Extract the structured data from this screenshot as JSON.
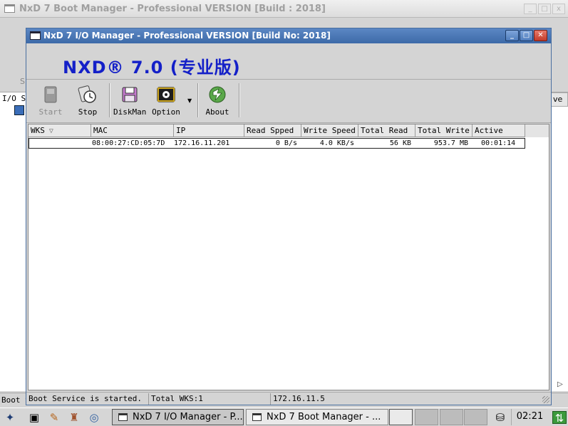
{
  "background_window": {
    "title": "NxD 7 Boot Manager - Professional VERSION [Build : 2018]",
    "tree_label": "I/O S",
    "status_text": "Boot S",
    "column_fragment": "ve",
    "tool_fragment": "S"
  },
  "main_window": {
    "title": "NxD 7 I/O Manager - Professional VERSION [Build No: 2018]",
    "banner": "NXD® 7.0 (专业版)",
    "toolbar": {
      "start_label": "Start",
      "stop_label": "Stop",
      "diskman_label": "DiskMan",
      "option_label": "Option",
      "about_label": "About"
    },
    "columns": [
      "WKS",
      "MAC",
      "IP",
      "Read Spped",
      "Write Speed",
      "Total Read",
      "Total Write",
      "Active"
    ],
    "rows": [
      {
        "wks": "",
        "mac": "08:00:27:CD:05:7D",
        "ip": "172.16.11.201",
        "read_speed": "0 B/s",
        "write_speed": "4.0 KB/s",
        "total_read": "56 KB",
        "total_write": "953.7 MB",
        "active": "00:01:14"
      }
    ],
    "status": {
      "message": "Boot Service is started.",
      "total_wks": "Total WKS:1",
      "server_ip": "172.16.11.5"
    }
  },
  "taskbar": {
    "tasks": [
      {
        "label": "NxD 7 I/O Manager - P..."
      },
      {
        "label": "NxD 7 Boot Manager - ..."
      }
    ],
    "clock": "02:21"
  },
  "colors": {
    "title_bar_active": "#3d6aa8",
    "banner_text": "#1420c8",
    "close_button": "#c23b2a"
  },
  "icons": [
    "window-icon",
    "start-icon",
    "stop-icon",
    "diskman-icon",
    "option-icon",
    "about-icon",
    "terminal-icon",
    "editor-icon",
    "paint-icon",
    "network-icon",
    "drive-icon",
    "update-icon"
  ]
}
